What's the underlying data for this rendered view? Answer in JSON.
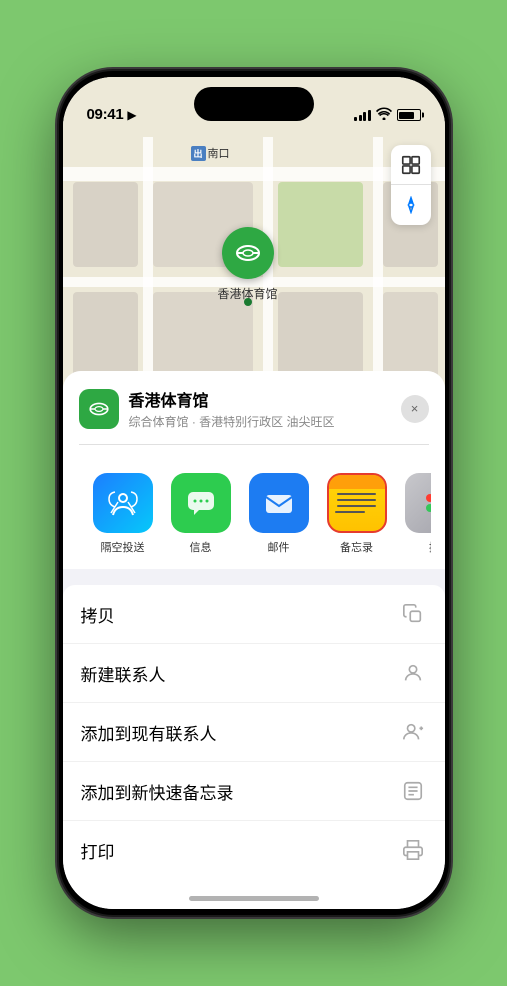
{
  "status_bar": {
    "time": "09:41",
    "location_arrow": "▶"
  },
  "map": {
    "label_badge": "南口",
    "label_badge_prefix": "出",
    "location_name": "香港体育馆",
    "pin_label": "香港体育馆"
  },
  "location_card": {
    "name": "香港体育馆",
    "subtitle": "综合体育馆 · 香港特别行政区 油尖旺区",
    "close_label": "×"
  },
  "share_items": [
    {
      "id": "airdrop",
      "label": "隔空投送"
    },
    {
      "id": "message",
      "label": "信息"
    },
    {
      "id": "mail",
      "label": "邮件"
    },
    {
      "id": "notes",
      "label": "备忘录"
    },
    {
      "id": "more",
      "label": "提"
    }
  ],
  "actions": [
    {
      "id": "copy",
      "label": "拷贝",
      "icon": "copy"
    },
    {
      "id": "new-contact",
      "label": "新建联系人",
      "icon": "person"
    },
    {
      "id": "add-contact",
      "label": "添加到现有联系人",
      "icon": "person-add"
    },
    {
      "id": "quick-note",
      "label": "添加到新快速备忘录",
      "icon": "note"
    },
    {
      "id": "print",
      "label": "打印",
      "icon": "print"
    }
  ],
  "icons": {
    "map_layers": "🗺",
    "compass": "➤",
    "stadium": "🏟"
  }
}
